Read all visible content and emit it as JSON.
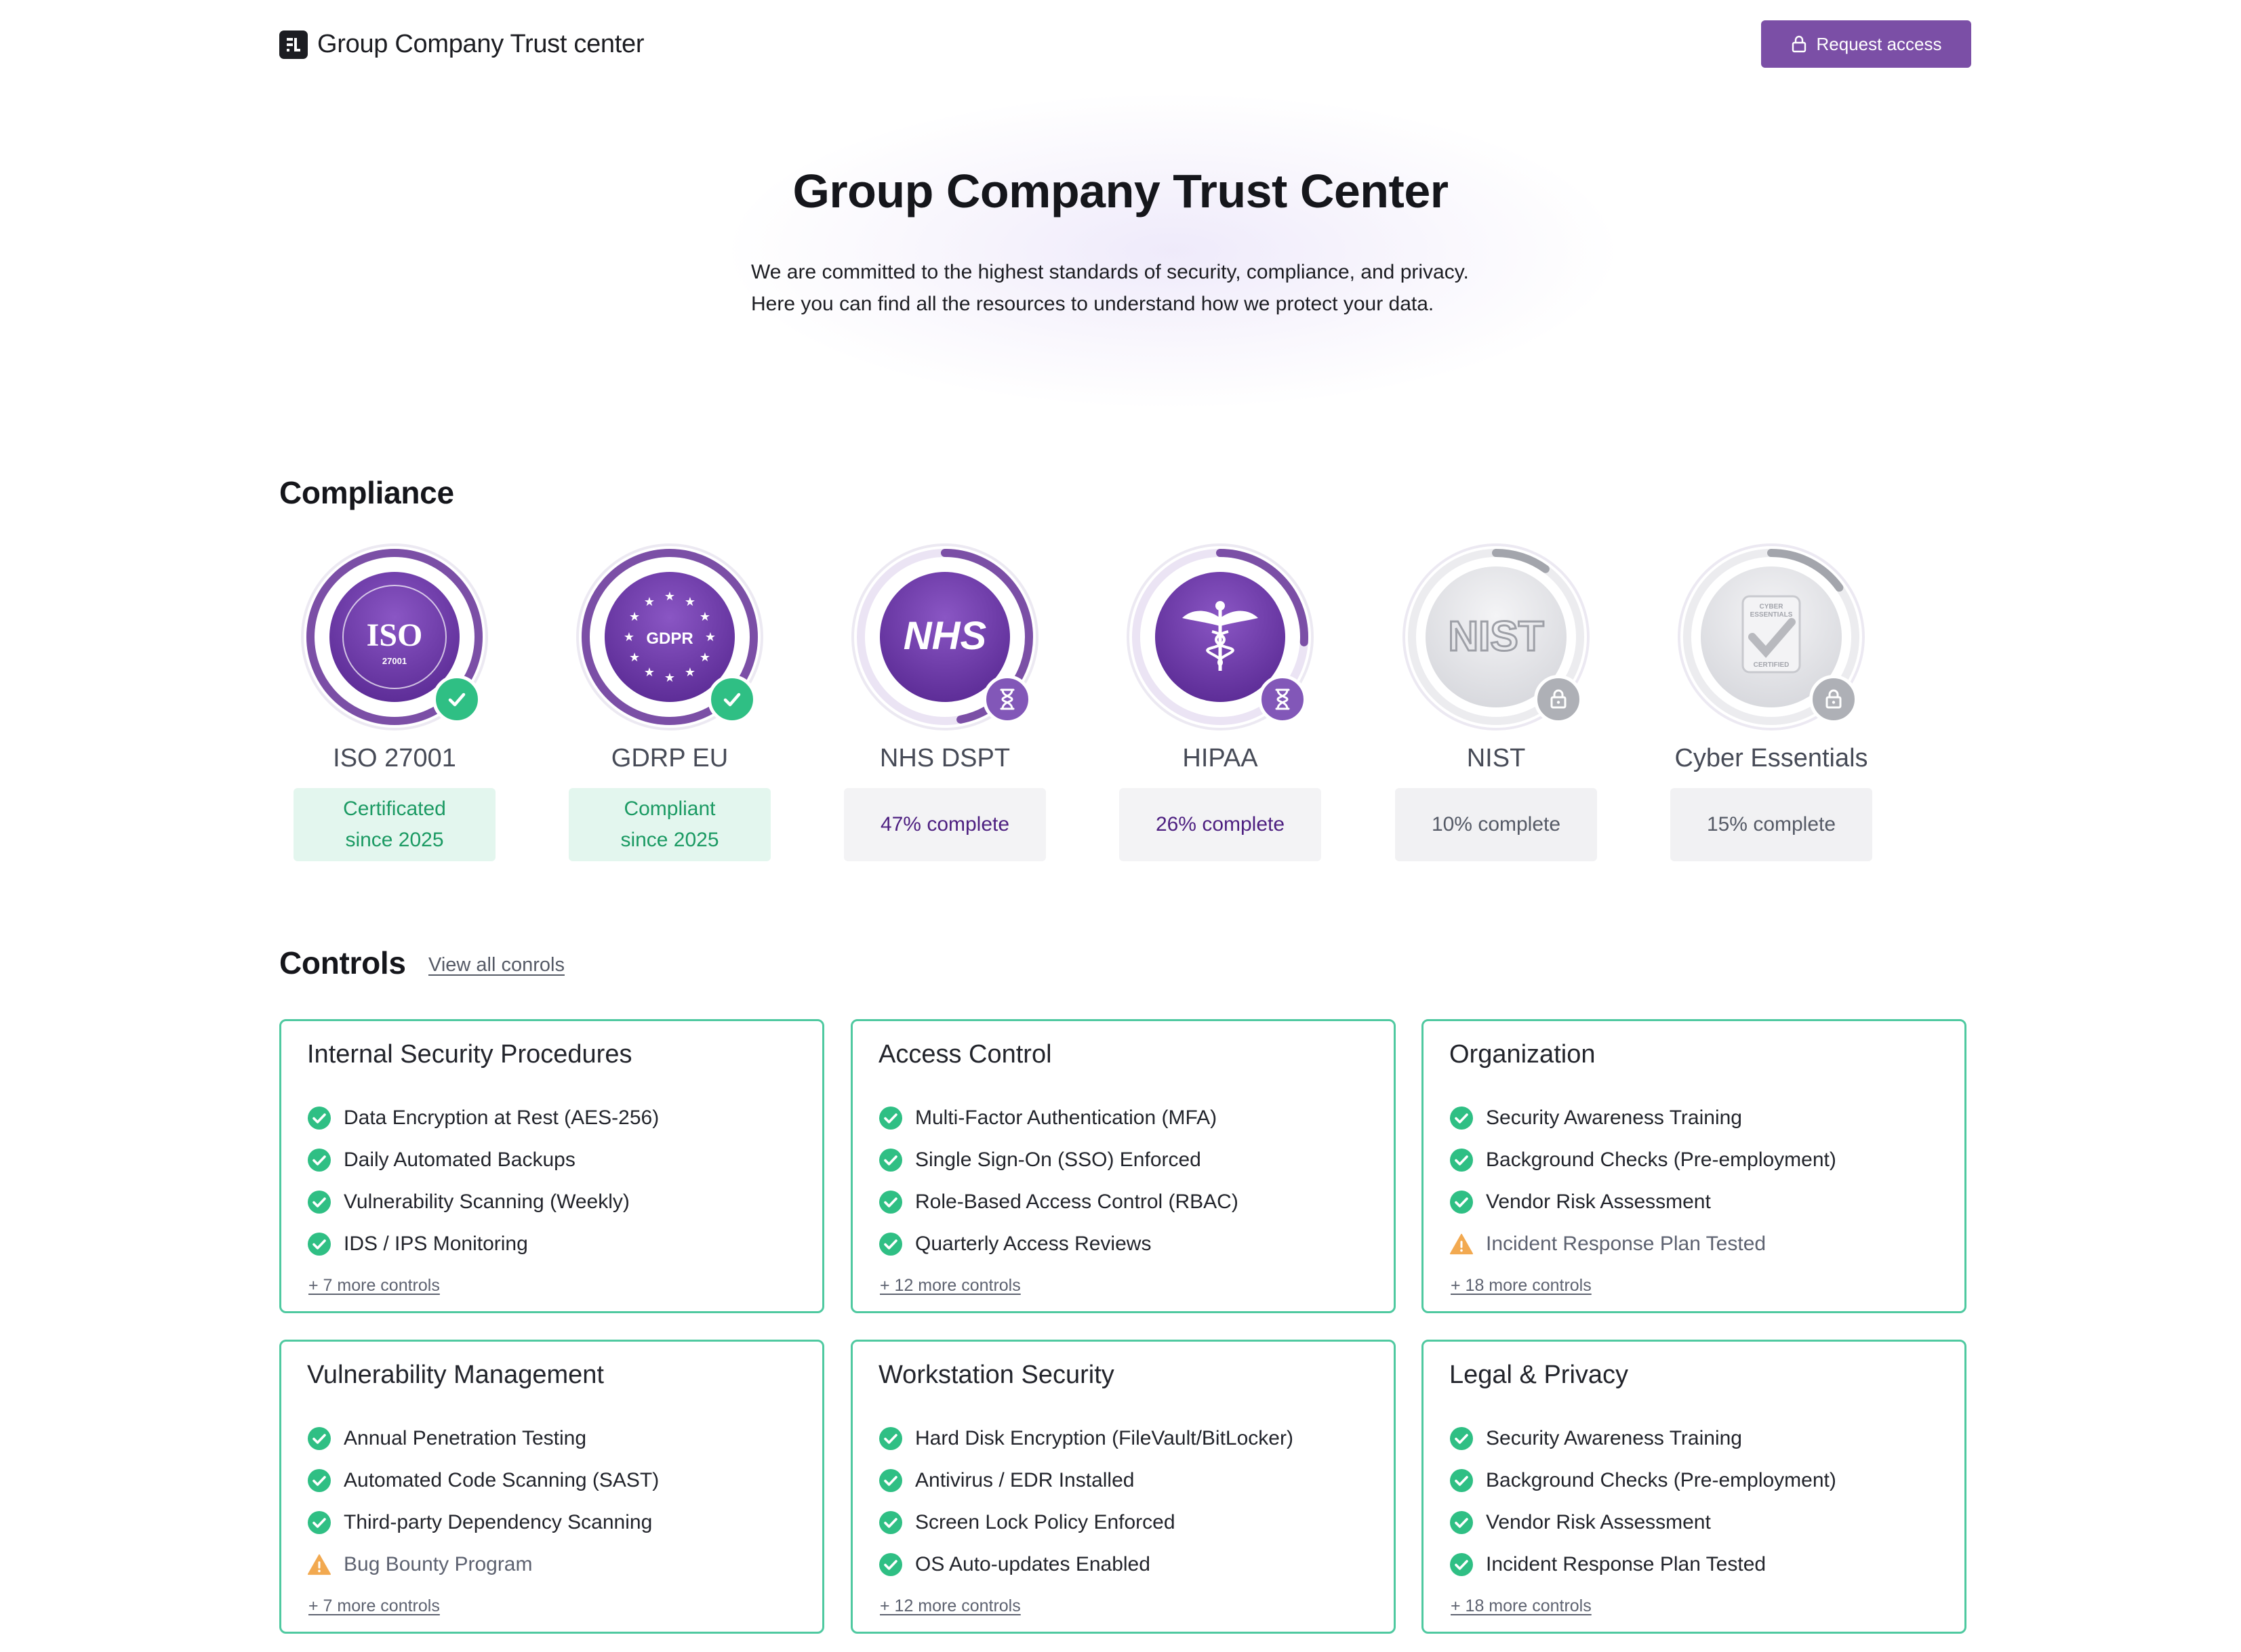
{
  "header": {
    "brand": "Group Company Trust center",
    "request_label": "Request access"
  },
  "hero": {
    "title": "Group Company Trust Center",
    "line1": "We are committed to the highest standards of security, compliance, and privacy.",
    "line2": "Here you can find all the resources to understand how we protect your data."
  },
  "compliance": {
    "title": "Compliance",
    "badges": [
      {
        "name": "ISO 27001",
        "status": "Certificated\nsince 2025",
        "state": "certified",
        "progress": 1.0,
        "emblem_text": "ISO",
        "emblem_sub": "27001"
      },
      {
        "name": "GDRP EU",
        "status": "Compliant\nsince 2025",
        "state": "certified",
        "progress": 1.0,
        "emblem_text": "GDPR"
      },
      {
        "name": "NHS DSPT",
        "status": "47% complete",
        "state": "in-progress",
        "progress": 0.47,
        "emblem_text": "NHS"
      },
      {
        "name": "HIPAA",
        "status": "26% complete",
        "state": "in-progress",
        "progress": 0.26
      },
      {
        "name": "NIST",
        "status": "10% complete",
        "state": "locked",
        "progress": 0.1,
        "emblem_text": "NIST"
      },
      {
        "name": "Cyber Essentials",
        "status": "15% complete",
        "state": "locked",
        "progress": 0.15,
        "emblem_text": "CYBER ESSENTIALS",
        "emblem_sub": "CERTIFIED"
      }
    ],
    "colors": {
      "certified": "#2fbf84",
      "progress": "#7b4fa6",
      "locked": "#a3a5ac"
    }
  },
  "controls": {
    "title": "Controls",
    "view_all": "View all conrols",
    "cards": [
      {
        "title": "Internal Security Procedures",
        "items": [
          {
            "label": "Data Encryption at Rest (AES-256)",
            "status": "ok"
          },
          {
            "label": "Daily Automated Backups",
            "status": "ok"
          },
          {
            "label": "Vulnerability Scanning (Weekly)",
            "status": "ok"
          },
          {
            "label": "IDS / IPS Monitoring",
            "status": "ok"
          }
        ],
        "more": "+ 7 more controls"
      },
      {
        "title": "Access Control",
        "items": [
          {
            "label": "Multi-Factor Authentication (MFA)",
            "status": "ok"
          },
          {
            "label": "Single Sign-On (SSO) Enforced",
            "status": "ok"
          },
          {
            "label": "Role-Based Access Control (RBAC)",
            "status": "ok"
          },
          {
            "label": "Quarterly Access Reviews",
            "status": "ok"
          }
        ],
        "more": "+ 12 more controls"
      },
      {
        "title": "Organization",
        "items": [
          {
            "label": "Security Awareness Training",
            "status": "ok"
          },
          {
            "label": "Background Checks (Pre-employment)",
            "status": "ok"
          },
          {
            "label": "Vendor Risk Assessment",
            "status": "ok"
          },
          {
            "label": "Incident Response Plan Tested",
            "status": "warn"
          }
        ],
        "more": "+ 18 more controls"
      },
      {
        "title": "Vulnerability Management",
        "items": [
          {
            "label": "Annual Penetration Testing",
            "status": "ok"
          },
          {
            "label": "Automated Code Scanning (SAST)",
            "status": "ok"
          },
          {
            "label": "Third-party Dependency Scanning",
            "status": "ok"
          },
          {
            "label": "Bug Bounty Program",
            "status": "warn"
          }
        ],
        "more": "+ 7 more controls"
      },
      {
        "title": "Workstation Security",
        "items": [
          {
            "label": "Hard Disk Encryption (FileVault/BitLocker)",
            "status": "ok"
          },
          {
            "label": "Antivirus / EDR Installed",
            "status": "ok"
          },
          {
            "label": "Screen Lock Policy Enforced",
            "status": "ok"
          },
          {
            "label": "OS Auto-updates Enabled",
            "status": "ok"
          }
        ],
        "more": "+ 12 more controls"
      },
      {
        "title": "Legal & Privacy",
        "items": [
          {
            "label": "Security Awareness Training",
            "status": "ok"
          },
          {
            "label": "Background Checks (Pre-employment)",
            "status": "ok"
          },
          {
            "label": "Vendor Risk Assessment",
            "status": "ok"
          },
          {
            "label": "Incident Response Plan Tested",
            "status": "ok"
          }
        ],
        "more": "+ 18 more controls"
      }
    ],
    "colors": {
      "ok": "#2fbf84",
      "warn": "#f2a950",
      "border": "#4fc9a0"
    }
  }
}
